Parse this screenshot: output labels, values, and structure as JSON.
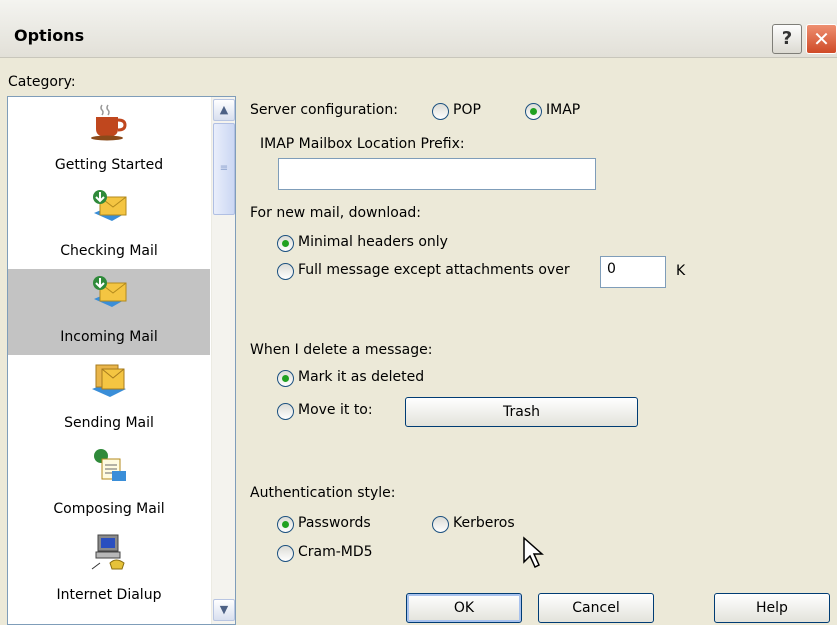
{
  "window": {
    "title": "Options",
    "help_glyph": "?",
    "close_glyph": "✕"
  },
  "sidebar": {
    "category_label": "Category:",
    "items": [
      {
        "label": "Getting Started",
        "icon": "coffee-cup-icon"
      },
      {
        "label": "Checking Mail",
        "icon": "envelope-download-icon"
      },
      {
        "label": "Incoming Mail",
        "icon": "envelope-download-icon",
        "selected": true
      },
      {
        "label": "Sending Mail",
        "icon": "envelopes-stack-icon"
      },
      {
        "label": "Composing Mail",
        "icon": "document-compose-icon"
      },
      {
        "label": "Internet Dialup",
        "icon": "computer-phone-icon"
      }
    ],
    "scroll_up": "▲",
    "scroll_down": "▼",
    "scroll_grip": "≡"
  },
  "server": {
    "label": "Server configuration:",
    "pop_label": "POP",
    "imap_label": "IMAP",
    "selected": "IMAP",
    "prefix_label": "IMAP Mailbox Location Prefix:",
    "prefix_value": ""
  },
  "download": {
    "label": "For new mail, download:",
    "minimal_label": "Minimal headers only",
    "full_label": "Full message except attachments over",
    "size_value": "0",
    "size_unit": "K",
    "selected": "Minimal headers only"
  },
  "delete": {
    "label": "When I delete a message:",
    "mark_label": "Mark it as deleted",
    "move_label": "Move it to:",
    "folder_button": "Trash",
    "selected": "Mark it as deleted"
  },
  "auth": {
    "label": "Authentication style:",
    "passwords_label": "Passwords",
    "kerberos_label": "Kerberos",
    "cram_label": "Cram-MD5",
    "selected": "Passwords"
  },
  "buttons": {
    "ok": "OK",
    "cancel": "Cancel",
    "help": "Help"
  },
  "colors": {
    "dialog_background": "#ece9d8",
    "selected_category": "#c3c3c3",
    "radio_dot": "#21a121",
    "close_button": "#cf4a27"
  }
}
